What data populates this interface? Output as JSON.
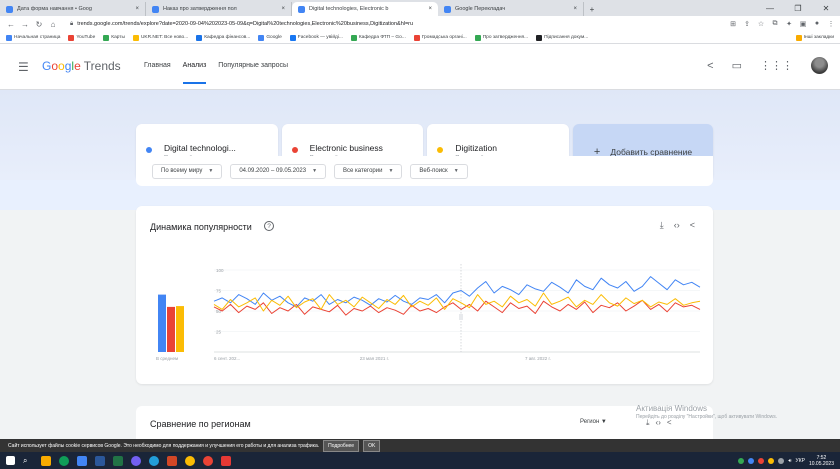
{
  "browser": {
    "tabs": [
      {
        "label": "Дата форма навчання • Goog",
        "color": "#4285f4",
        "active": false
      },
      {
        "label": "Наказ про затвердження пол",
        "color": "#4285f4",
        "active": false
      },
      {
        "label": "Digital technologies, Electronic b",
        "color": "#4285f4",
        "active": true
      },
      {
        "label": "Google Перекладач",
        "color": "#4285f4",
        "active": false
      }
    ],
    "new_tab": "+",
    "url": "trends.google.com/trends/explore?date=2020-09-04%202023-05-09&q=Digital%20technologies,Electronic%20business,Digitization&hl=ru",
    "bookmarks": [
      {
        "label": "Начальная страница",
        "color": "#4285f4"
      },
      {
        "label": "YouTube",
        "color": "#ea4335"
      },
      {
        "label": "Карты",
        "color": "#34a853"
      },
      {
        "label": "UKR.NET: Все ново...",
        "color": "#fbbc04"
      },
      {
        "label": "Кафедра фінансов...",
        "color": "#1a73e8"
      },
      {
        "label": "Google",
        "color": "#4285f4"
      },
      {
        "label": "Facebook — увійді...",
        "color": "#1877f2"
      },
      {
        "label": "Кафедра ФТП – Go...",
        "color": "#34a853"
      },
      {
        "label": "Громадська органі...",
        "color": "#ea4335"
      },
      {
        "label": "Про затвердження...",
        "color": "#34a853"
      },
      {
        "label": "Підписання докум...",
        "color": "#202124"
      }
    ],
    "bookmarks_other": "Інші закладки"
  },
  "trends": {
    "logo_product": "Trends",
    "nav": [
      {
        "label": "Главная",
        "active": false
      },
      {
        "label": "Анализ",
        "active": true
      },
      {
        "label": "Популярные запросы",
        "active": false
      }
    ],
    "terms": [
      {
        "name": "Digital technologi...",
        "type": "Поисковый запрос",
        "color": "#4285f4"
      },
      {
        "name": "Electronic business",
        "type": "Поисковый запрос",
        "color": "#ea4335"
      },
      {
        "name": "Digitization",
        "type": "Поисковый запрос",
        "color": "#fbbc04"
      }
    ],
    "add_compare": "Добавить сравнение",
    "filters": {
      "region": "По всему миру",
      "date": "04.09.2020 – 09.05.2023",
      "category": "Все категории",
      "search_type": "Веб-поиск"
    },
    "interest_title": "Динамика популярности",
    "regions_title": "Сравнение по регионам",
    "regions_filter": "Регион"
  },
  "chart_data": {
    "type": "line",
    "yticks": [
      25,
      50,
      75,
      100
    ],
    "ylim": [
      0,
      100
    ],
    "xticks": [
      "6 сент. 202...",
      "23 мая 2021 г.",
      "7 авг. 2022 г."
    ],
    "average_label": "В среднем",
    "averages": [
      {
        "name": "Digital technologies",
        "value": 70,
        "color": "#4285f4"
      },
      {
        "name": "Electronic business",
        "value": 55,
        "color": "#ea4335"
      },
      {
        "name": "Digitization",
        "value": 56,
        "color": "#fbbc04"
      }
    ],
    "series": [
      {
        "name": "Digital technologies",
        "color": "#4285f4",
        "values": [
          62,
          66,
          60,
          70,
          65,
          58,
          72,
          63,
          68,
          60,
          55,
          66,
          62,
          70,
          58,
          64,
          60,
          67,
          63,
          57,
          65,
          61,
          69,
          62,
          58,
          66,
          64,
          70,
          60,
          72,
          75,
          68,
          78,
          86,
          72,
          80,
          76,
          70,
          82,
          77,
          74,
          85,
          79,
          72,
          88,
          80,
          76,
          90,
          82,
          78,
          86,
          74,
          80,
          92,
          84,
          76,
          88,
          82,
          85,
          79
        ]
      },
      {
        "name": "Electronic business",
        "color": "#ea4335",
        "values": [
          55,
          50,
          58,
          48,
          56,
          52,
          60,
          47,
          54,
          50,
          58,
          46,
          55,
          52,
          49,
          57,
          45,
          53,
          50,
          56,
          48,
          54,
          51,
          46,
          57,
          50,
          53,
          48,
          55,
          60,
          52,
          58,
          50,
          62,
          55,
          48,
          60,
          53,
          56,
          47,
          62,
          55,
          50,
          58,
          52,
          61,
          48,
          57,
          54,
          60,
          50,
          56,
          63,
          52,
          58,
          49,
          60,
          55,
          57,
          52
        ]
      },
      {
        "name": "Digitization",
        "color": "#fbbc04",
        "values": [
          58,
          52,
          64,
          55,
          60,
          66,
          50,
          63,
          57,
          68,
          54,
          61,
          65,
          52,
          70,
          58,
          63,
          55,
          67,
          60,
          53,
          64,
          58,
          69,
          55,
          62,
          57,
          66,
          52,
          65,
          60,
          54,
          70,
          58,
          62,
          55,
          68,
          60,
          64,
          56,
          72,
          58,
          62,
          67,
          55,
          63,
          58,
          70,
          60,
          56,
          66,
          59,
          63,
          55,
          61,
          58,
          65,
          57,
          60,
          62
        ]
      }
    ]
  },
  "cookie_bar": {
    "text": "Сайт использует файлы cookie сервисов Google. Это необходимо для поддержания и улучшения его работы и для анализа трафика.",
    "more": "Подробнее",
    "ok": "OK"
  },
  "activation": {
    "title": "Активація Windows",
    "subtitle": "Перейдіть до розділу \"Настройки\", щоб активувати Windows."
  },
  "taskbar": {
    "lang": "УКР",
    "time": "7:52",
    "date": "10.05.2023"
  }
}
